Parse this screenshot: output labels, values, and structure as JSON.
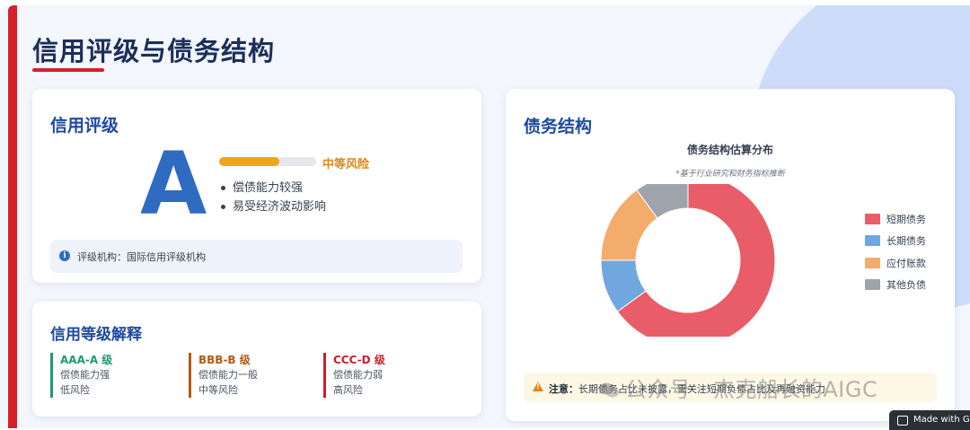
{
  "page": {
    "title": "信用评级与债务结构"
  },
  "rating_card": {
    "title": "信用评级",
    "grade": "A",
    "risk_label": "中等风险",
    "risk_level_fraction": 0.62,
    "points": [
      "偿债能力较强",
      "易受经济波动影响"
    ],
    "agency": "评级机构：国际信用评级机构"
  },
  "levels_card": {
    "title": "信用等级解释",
    "levels": [
      {
        "name": "AAA-A 级",
        "capacity": "偿债能力强",
        "risk": "低风险",
        "color": "#1c9b6a"
      },
      {
        "name": "BBB-B 级",
        "capacity": "偿债能力一般",
        "risk": "中等风险",
        "color": "#b25a12"
      },
      {
        "name": "CCC-D 级",
        "capacity": "偿债能力弱",
        "risk": "高风险",
        "color": "#c8202a"
      }
    ]
  },
  "debt_card": {
    "title": "债务结构",
    "warning_label": "注意：",
    "warning_text": "长期债务占比未披露，需关注短期负债占比及再融资能力"
  },
  "chart_data": {
    "type": "pie",
    "title": "债务结构估算分布",
    "subtitle": "*基于行业研究和财务指标推断",
    "categories": [
      "短期债务",
      "长期债务",
      "应付账款",
      "其他负债"
    ],
    "values": [
      65,
      10,
      15,
      10
    ],
    "colors": [
      "#e85d67",
      "#6fa7de",
      "#f3ac6c",
      "#9ea3ad"
    ],
    "legend": "right"
  },
  "watermark": {
    "text": "公众号 · 杰克船长的AIGC"
  },
  "badge": {
    "text": "Made with Ge"
  }
}
